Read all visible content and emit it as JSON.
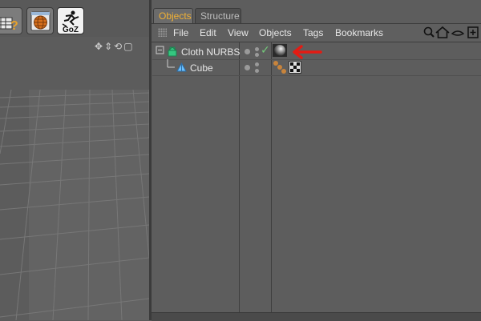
{
  "tabs": [
    {
      "label": "Objects",
      "active": true
    },
    {
      "label": "Structure",
      "active": false
    }
  ],
  "menu": [
    "File",
    "Edit",
    "View",
    "Objects",
    "Tags",
    "Bookmarks"
  ],
  "toolbar": {
    "goz_label": "GoZ"
  },
  "objects": [
    {
      "name": "Cloth NURBS",
      "enabled": true,
      "tag_icon": "material-sphere-icon",
      "level": 0
    },
    {
      "name": "Cube",
      "enabled": null,
      "tag_icon": "checker-texture-icon",
      "level": 1
    }
  ],
  "viewport_nav_icons": [
    "move-icon",
    "scale-icon",
    "rotate-icon",
    "maximize-icon"
  ],
  "colors": {
    "active_tab_text": "#f2b134",
    "annotation_arrow": "#e41b13",
    "check": "#74c97a",
    "cube_icon": "#6cc1ff",
    "nurbs_icon": "#35c780"
  }
}
